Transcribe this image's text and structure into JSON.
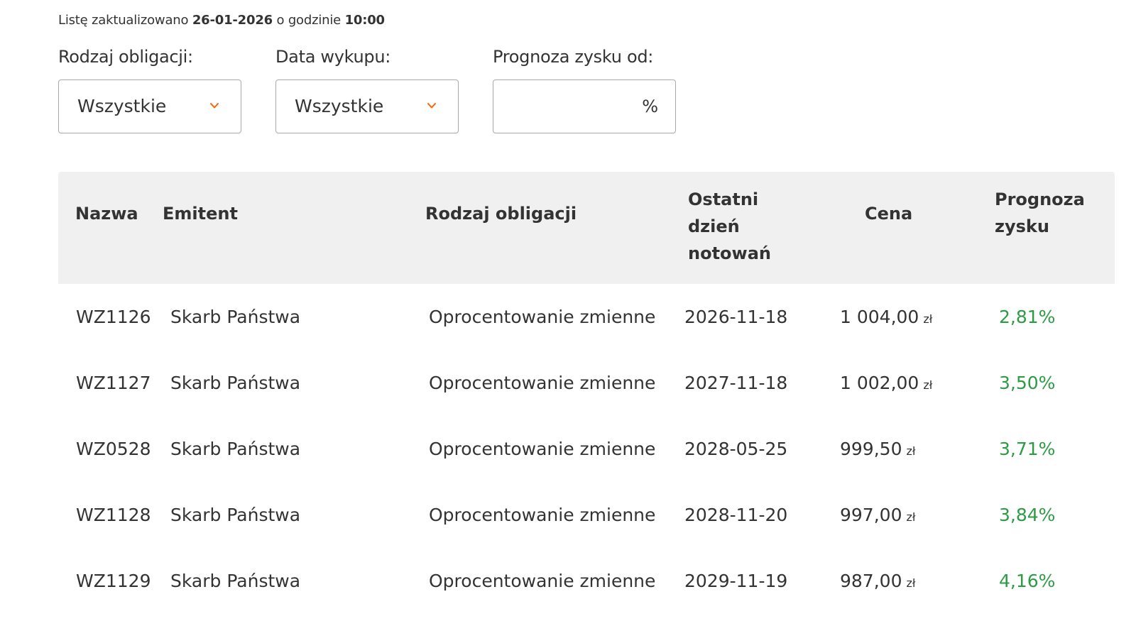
{
  "update": {
    "prefix": "Listę zaktualizowano",
    "date": "26-01-2026",
    "middle": "o godzinie",
    "time": "10:00"
  },
  "filters": {
    "type": {
      "label": "Rodzaj obligacji:",
      "value": "Wszystkie"
    },
    "redemption": {
      "label": "Data wykupu:",
      "value": "Wszystkie"
    },
    "profit": {
      "label": "Prognoza zysku od:",
      "value": "",
      "unit": "%"
    }
  },
  "table": {
    "headers": {
      "name": "Nazwa",
      "issuer": "Emitent",
      "type": "Rodzaj obligacji",
      "last_day_1": "Ostatni dzień",
      "last_day_2": "notowań",
      "price": "Cena",
      "forecast_1": "Prognoza",
      "forecast_2": "zysku"
    },
    "rows": [
      {
        "name": "WZ1126",
        "issuer": "Skarb Państwa",
        "type": "Oprocentowanie zmienne",
        "last_day": "2026-11-18",
        "price": "1 004,00",
        "currency": "zł",
        "forecast": "2,81%"
      },
      {
        "name": "WZ1127",
        "issuer": "Skarb Państwa",
        "type": "Oprocentowanie zmienne",
        "last_day": "2027-11-18",
        "price": "1 002,00",
        "currency": "zł",
        "forecast": "3,50%"
      },
      {
        "name": "WZ0528",
        "issuer": "Skarb Państwa",
        "type": "Oprocentowanie zmienne",
        "last_day": "2028-05-25",
        "price": "999,50",
        "currency": "zł",
        "forecast": "3,71%"
      },
      {
        "name": "WZ1128",
        "issuer": "Skarb Państwa",
        "type": "Oprocentowanie zmienne",
        "last_day": "2028-11-20",
        "price": "997,00",
        "currency": "zł",
        "forecast": "3,84%"
      },
      {
        "name": "WZ1129",
        "issuer": "Skarb Państwa",
        "type": "Oprocentowanie zmienne",
        "last_day": "2029-11-19",
        "price": "987,00",
        "currency": "zł",
        "forecast": "4,16%"
      }
    ]
  },
  "colors": {
    "accent": "#ff6200",
    "positive": "#2e9b44",
    "header_bg": "#f0f0f0"
  },
  "icons": {
    "dropdown": "chevron-down-icon"
  }
}
